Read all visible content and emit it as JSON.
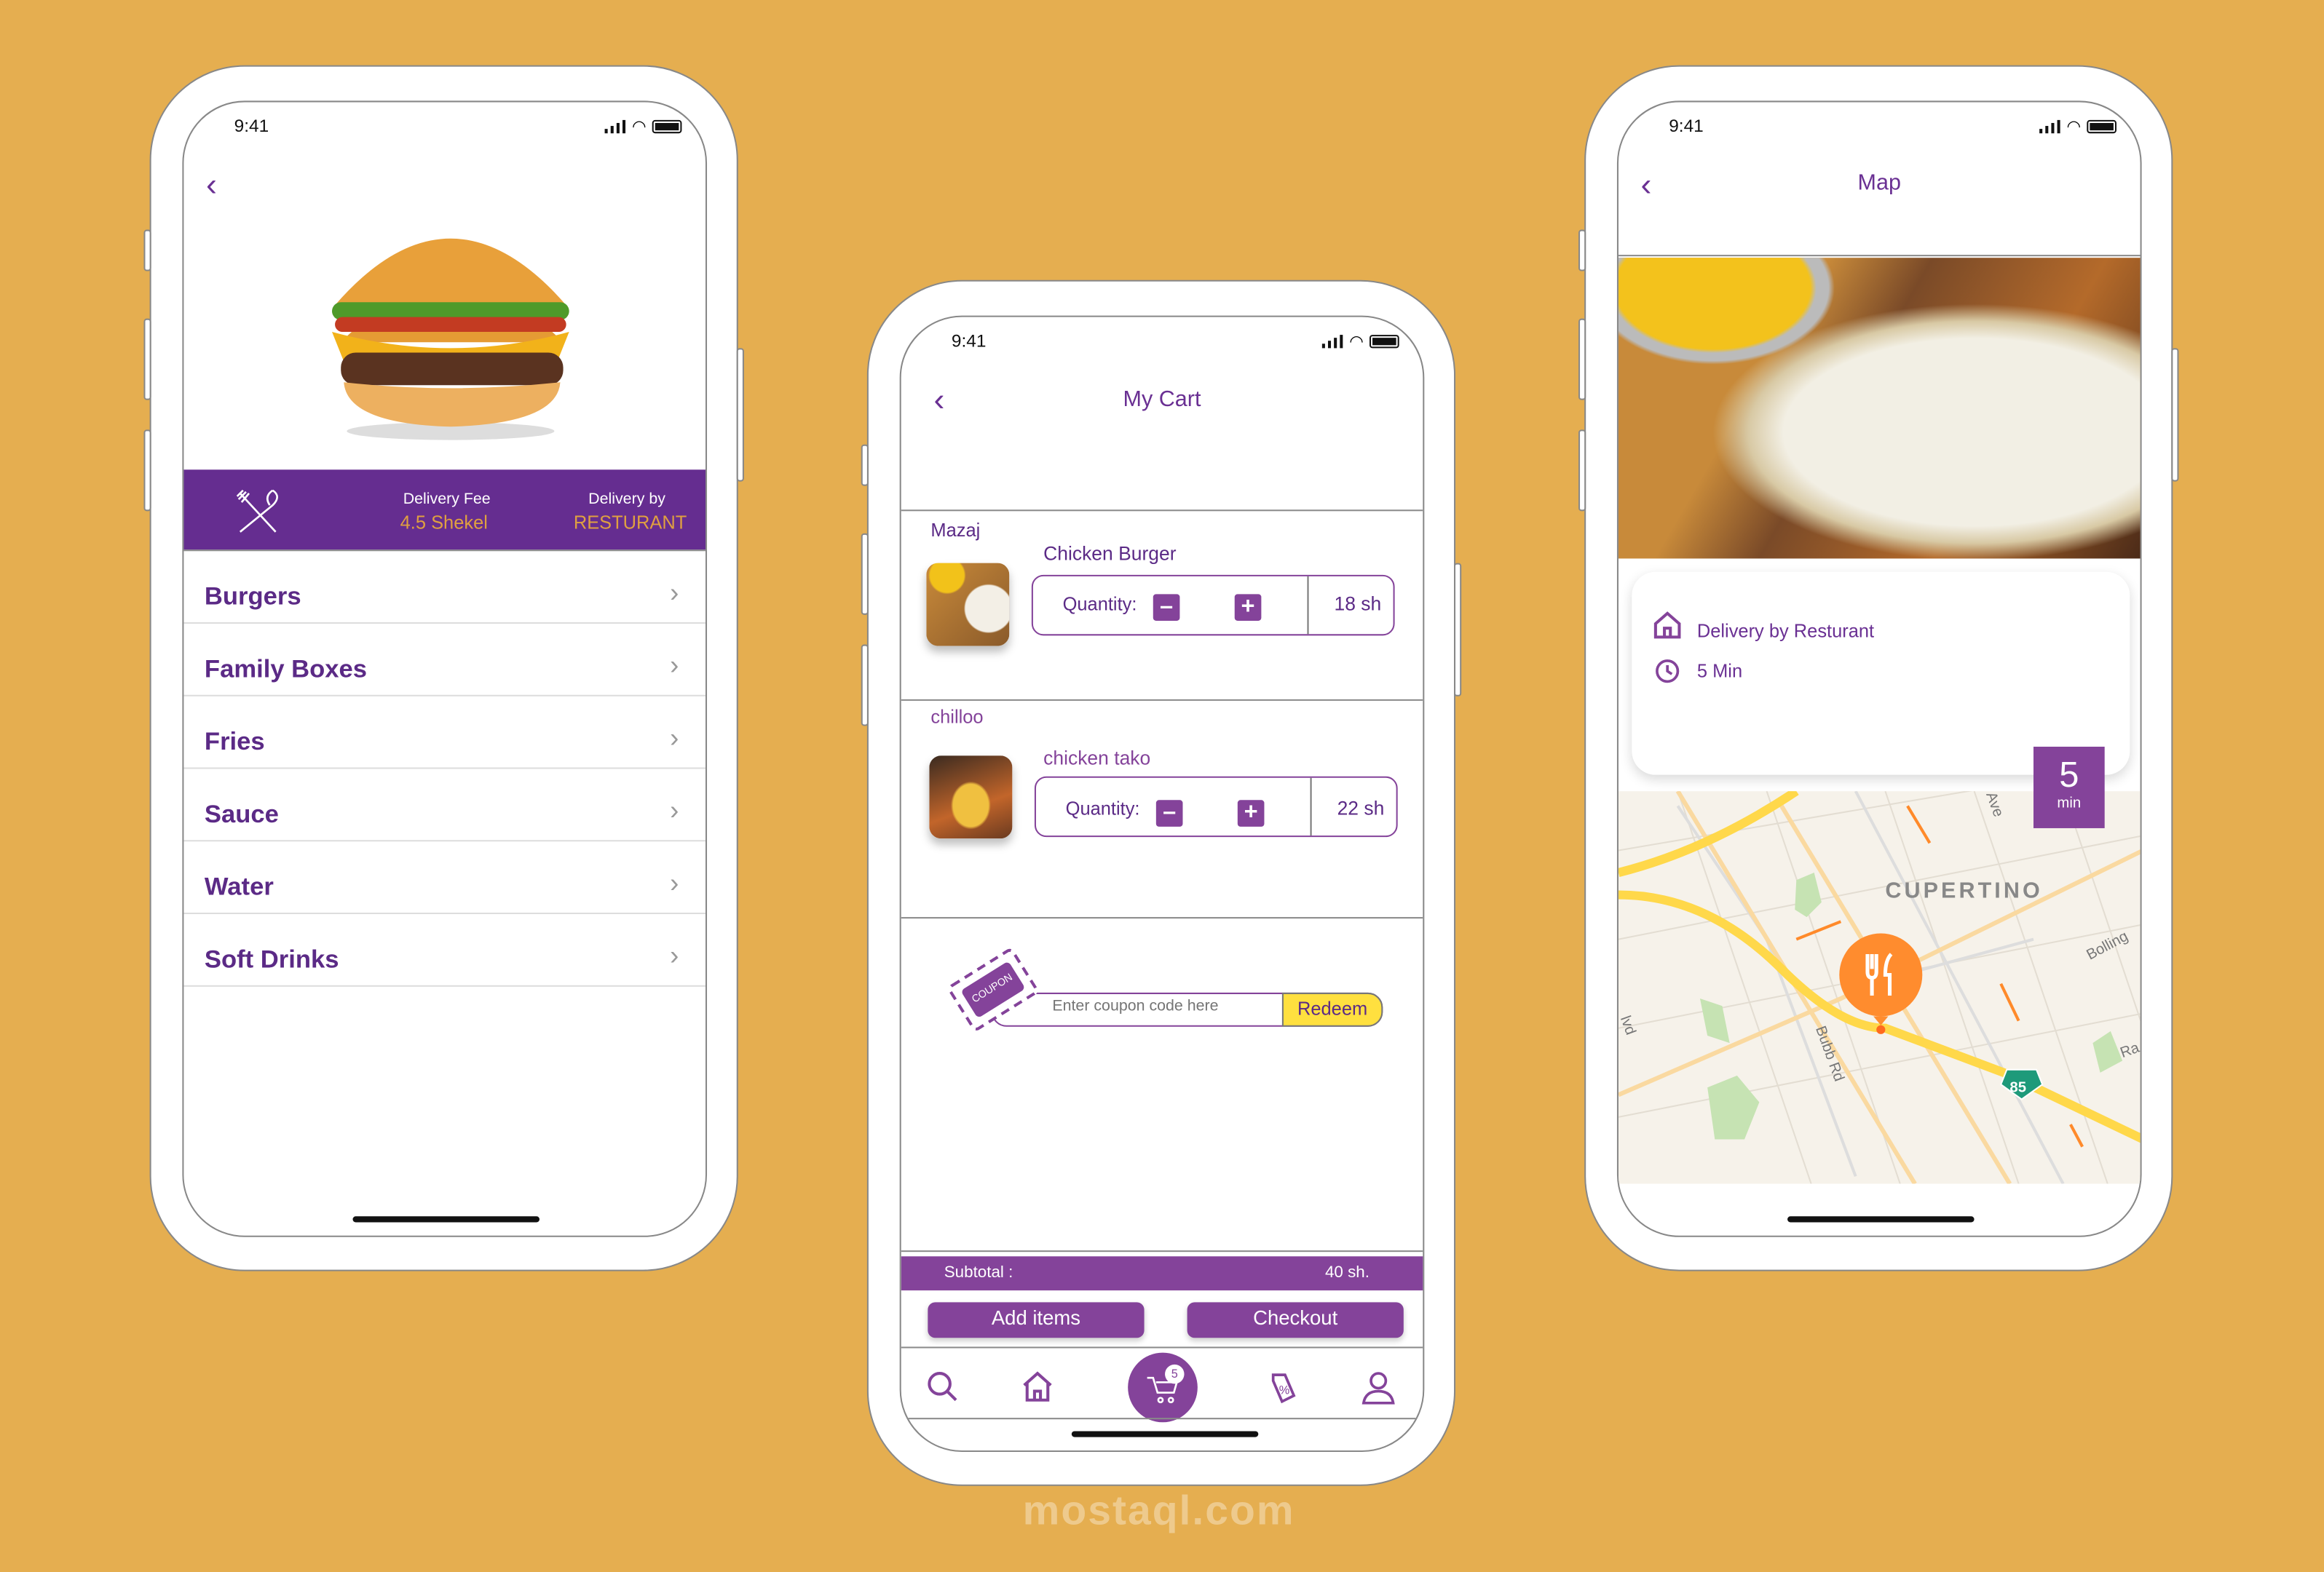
{
  "colors": {
    "background": "#E5AE50",
    "primary": "#652D90",
    "button": "#84439A",
    "accent_gold": "#E0A040",
    "redeem_yellow": "#FFE03F",
    "pin_orange": "#FF8C2E"
  },
  "status_bar": {
    "time": "9:41"
  },
  "menu_screen": {
    "band": {
      "icon": "fork-spoon-icon",
      "fee_label": "Delivery Fee",
      "fee_value": "4.5 Shekel",
      "by_label": "Delivery by",
      "by_value": "RESTURANT"
    },
    "categories": [
      {
        "label": "Burgers"
      },
      {
        "label": "Family Boxes"
      },
      {
        "label": "Fries"
      },
      {
        "label": "Sauce"
      },
      {
        "label": "Water"
      },
      {
        "label": "Soft Drinks"
      }
    ]
  },
  "cart_screen": {
    "title": "My Cart",
    "items": [
      {
        "restaurant": "Mazaj",
        "name": "Chicken Burger",
        "quantity_label": "Quantity:",
        "price": "18 sh"
      },
      {
        "restaurant": "chilloo",
        "name": "chicken tako",
        "quantity_label": "Quantity:",
        "price": "22 sh"
      }
    ],
    "coupon": {
      "badge": "COUPON",
      "placeholder": "Enter coupon code here",
      "redeem": "Redeem"
    },
    "subtotal_label": "Subtotal :",
    "subtotal_value": "40 sh.",
    "add_items": "Add items",
    "checkout": "Checkout",
    "nav": {
      "items": [
        "search-icon",
        "home-icon",
        "cart-icon",
        "offers-tag-icon",
        "profile-icon"
      ],
      "cart_badge": "5",
      "active": "cart"
    }
  },
  "map_screen": {
    "title": "Map",
    "delivery_by": "Delivery by Resturant",
    "eta": "5 Min",
    "badge_number": "5",
    "badge_unit": "min",
    "map_labels": {
      "city": "CUPERTINO",
      "road1": "Bubb Rd",
      "road2": "Bolling",
      "road3": "Ave",
      "road4": "Ra",
      "road5": "lvd",
      "highway": "85"
    }
  },
  "watermark": "mostaql.com"
}
